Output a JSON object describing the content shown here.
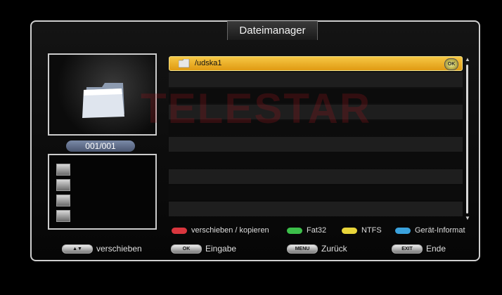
{
  "header": {
    "title": "Dateimanager"
  },
  "preview": {
    "counter": "001/001"
  },
  "watermark": "TELESTAR",
  "file_list": {
    "selected_item": {
      "label": "/udska1",
      "ok_badge": "OK"
    }
  },
  "color_keys": [
    {
      "color": "#d9363e",
      "label": "verschieben / kopieren"
    },
    {
      "color": "#3cbf4a",
      "label": "Fat32"
    },
    {
      "color": "#e8d53a",
      "label": "NTFS"
    },
    {
      "color": "#3aa2dd",
      "label": "Gerät-Informat"
    }
  ],
  "bottom_buttons": [
    {
      "key": "▲▼",
      "label": "verschieben"
    },
    {
      "key": "OK",
      "label": "Eingabe"
    },
    {
      "key": "MENU",
      "label": "Zurück"
    },
    {
      "key": "EXIT",
      "label": "Ende"
    }
  ],
  "device_icons": [
    "hdd-icon",
    "user-icon",
    "monitor-icon",
    "network-icon"
  ]
}
